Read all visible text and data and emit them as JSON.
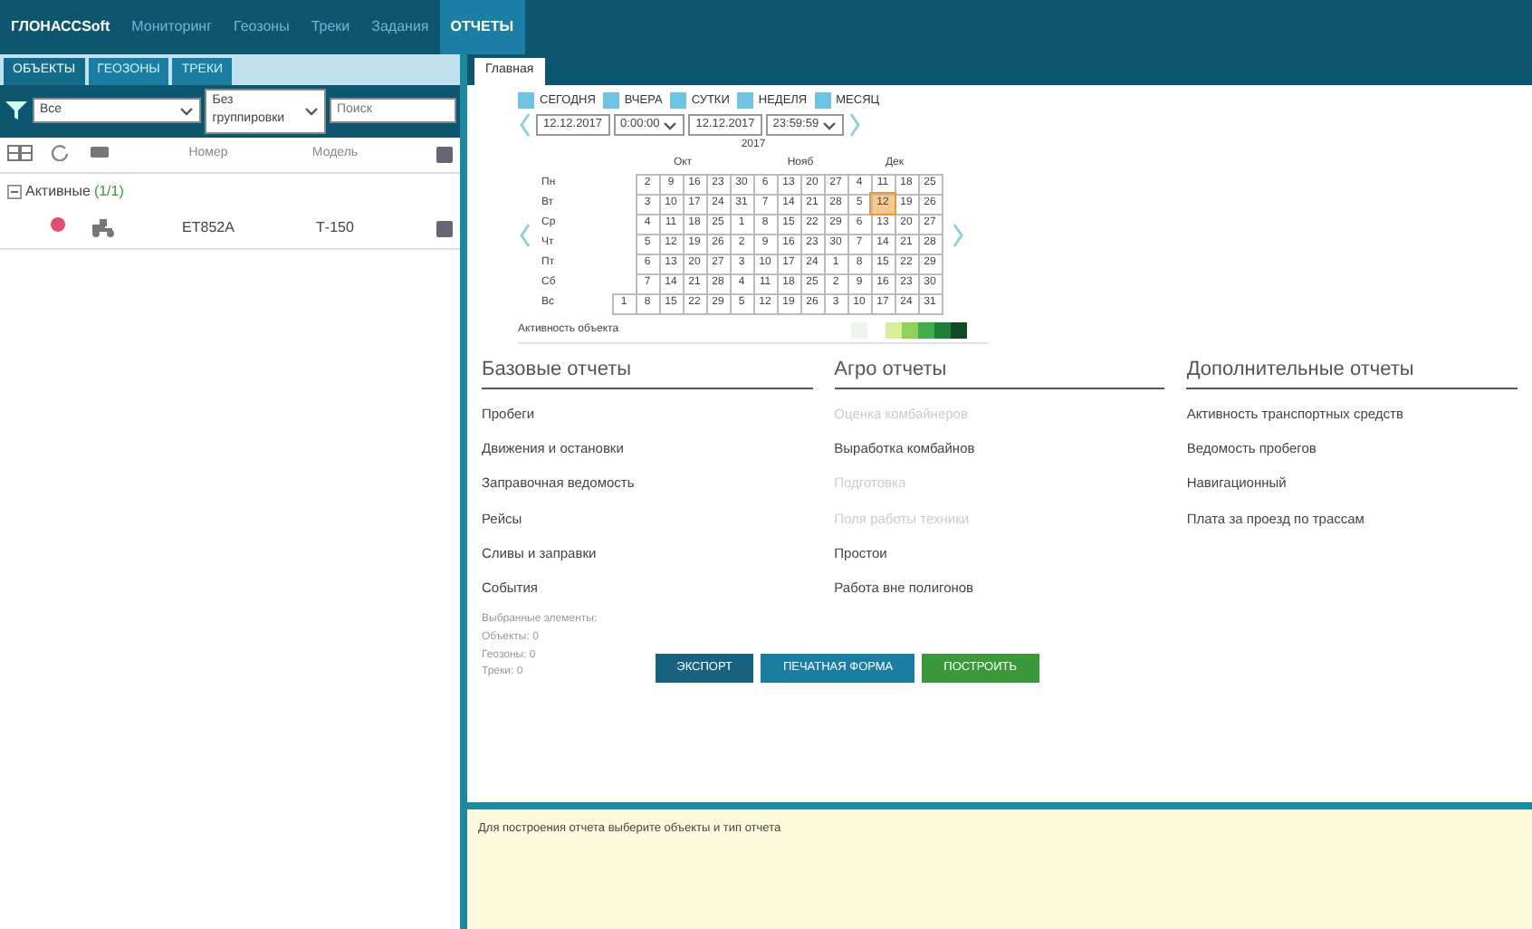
{
  "app": {
    "logo": "ГЛОНАССSoft",
    "menu": [
      {
        "label": "Мониторинг",
        "selected": false
      },
      {
        "label": "Геозоны",
        "selected": false
      },
      {
        "label": "Треки",
        "selected": false
      },
      {
        "label": "Задания",
        "selected": false
      },
      {
        "label": "ОТЧЕТЫ",
        "selected": true
      }
    ],
    "left_panel": {
      "tabs": [
        {
          "label": "ОБЪЕКТЫ",
          "selected": true
        },
        {
          "label": "ГЕОЗОНЫ",
          "selected": false
        },
        {
          "label": "ТРЕКИ",
          "selected": false
        }
      ],
      "filter": {
        "group": "Все",
        "grouping": "Без группировки",
        "search_placeholder": "Поиск"
      },
      "columns": [
        "Номер",
        "Модель"
      ],
      "groups": [
        {
          "name": "Активные",
          "count": "(1/1)",
          "expanded": true,
          "rows": [
            {
              "color": "#e0506a",
              "number": "ЕТ852А",
              "model": "Т-150"
            }
          ]
        }
      ]
    },
    "right_panel": {
      "tabs": [
        {
          "label": "Главная",
          "selected": true
        }
      ],
      "periods": [
        {
          "label": "СЕГОДНЯ",
          "checked": false
        },
        {
          "label": "ВЧЕРА",
          "checked": false
        },
        {
          "label": "СУТКИ",
          "checked": false
        },
        {
          "label": "НЕДЕЛЯ",
          "checked": false
        },
        {
          "label": "МЕСЯЦ",
          "checked": false
        }
      ],
      "from": {
        "date": "12.12.2017",
        "time": "0:00:00"
      },
      "to": {
        "date": "12.12.2017",
        "time": "23:59:59"
      },
      "calendar": {
        "year": "2017",
        "months": [
          "Окт",
          "Нояб",
          "Дек"
        ],
        "rows": [
          {
            "weekday": "Пн",
            "days": [
              {
                "day": "2",
                "selected": false
              },
              {
                "day": "9",
                "selected": false
              },
              {
                "day": "16",
                "selected": false
              },
              {
                "day": "23",
                "selected": false
              },
              {
                "day": "30",
                "selected": false
              },
              {
                "day": "6",
                "selected": false
              },
              {
                "day": "13",
                "selected": false
              },
              {
                "day": "20",
                "selected": false
              },
              {
                "day": "27",
                "selected": false
              },
              {
                "day": "4",
                "selected": false
              },
              {
                "day": "11",
                "selected": false
              },
              {
                "day": "18",
                "selected": false
              },
              {
                "day": "25",
                "selected": false
              }
            ]
          },
          {
            "weekday": "Вт",
            "days": [
              {
                "day": "3",
                "selected": false
              },
              {
                "day": "10",
                "selected": false
              },
              {
                "day": "17",
                "selected": false
              },
              {
                "day": "24",
                "selected": false
              },
              {
                "day": "31",
                "selected": false
              },
              {
                "day": "7",
                "selected": false
              },
              {
                "day": "14",
                "selected": false
              },
              {
                "day": "21",
                "selected": false
              },
              {
                "day": "28",
                "selected": false
              },
              {
                "day": "5",
                "selected": false
              },
              {
                "day": "12",
                "selected": true
              },
              {
                "day": "19",
                "selected": false
              },
              {
                "day": "26",
                "selected": false
              }
            ]
          },
          {
            "weekday": "Ср",
            "days": [
              {
                "day": "4",
                "selected": false
              },
              {
                "day": "11",
                "selected": false
              },
              {
                "day": "18",
                "selected": false
              },
              {
                "day": "25",
                "selected": false
              },
              {
                "day": "1",
                "selected": false
              },
              {
                "day": "8",
                "selected": false
              },
              {
                "day": "15",
                "selected": false
              },
              {
                "day": "22",
                "selected": false
              },
              {
                "day": "29",
                "selected": false
              },
              {
                "day": "6",
                "selected": false
              },
              {
                "day": "13",
                "selected": false
              },
              {
                "day": "20",
                "selected": false
              },
              {
                "day": "27",
                "selected": false
              }
            ]
          },
          {
            "weekday": "Чт",
            "days": [
              {
                "day": "5",
                "selected": false
              },
              {
                "day": "12",
                "selected": false
              },
              {
                "day": "19",
                "selected": false
              },
              {
                "day": "26",
                "selected": false
              },
              {
                "day": "2",
                "selected": false
              },
              {
                "day": "9",
                "selected": false
              },
              {
                "day": "16",
                "selected": false
              },
              {
                "day": "23",
                "selected": false
              },
              {
                "day": "30",
                "selected": false
              },
              {
                "day": "7",
                "selected": false
              },
              {
                "day": "14",
                "selected": false
              },
              {
                "day": "21",
                "selected": false
              },
              {
                "day": "28",
                "selected": false
              }
            ]
          },
          {
            "weekday": "Пт",
            "days": [
              {
                "day": "6",
                "selected": false
              },
              {
                "day": "13",
                "selected": false
              },
              {
                "day": "20",
                "selected": false
              },
              {
                "day": "27",
                "selected": false
              },
              {
                "day": "3",
                "selected": false
              },
              {
                "day": "10",
                "selected": false
              },
              {
                "day": "17",
                "selected": false
              },
              {
                "day": "24",
                "selected": false
              },
              {
                "day": "1",
                "selected": false
              },
              {
                "day": "8",
                "selected": false
              },
              {
                "day": "15",
                "selected": false
              },
              {
                "day": "22",
                "selected": false
              },
              {
                "day": "29",
                "selected": false
              }
            ]
          },
          {
            "weekday": "Сб",
            "days": [
              {
                "day": "7",
                "selected": false
              },
              {
                "day": "14",
                "selected": false
              },
              {
                "day": "21",
                "selected": false
              },
              {
                "day": "28",
                "selected": false
              },
              {
                "day": "4",
                "selected": false
              },
              {
                "day": "11",
                "selected": false
              },
              {
                "day": "18",
                "selected": false
              },
              {
                "day": "25",
                "selected": false
              },
              {
                "day": "2",
                "selected": false
              },
              {
                "day": "9",
                "selected": false
              },
              {
                "day": "16",
                "selected": false
              },
              {
                "day": "23",
                "selected": false
              },
              {
                "day": "30",
                "selected": false
              }
            ]
          },
          {
            "weekday": "Вс",
            "days": [
              {
                "day": "1",
                "selected": false
              },
              {
                "day": "8",
                "selected": false
              },
              {
                "day": "15",
                "selected": false
              },
              {
                "day": "22",
                "selected": false
              },
              {
                "day": "29",
                "selected": false
              },
              {
                "day": "5",
                "selected": false
              },
              {
                "day": "12",
                "selected": false
              },
              {
                "day": "19",
                "selected": false
              },
              {
                "day": "26",
                "selected": false
              },
              {
                "day": "3",
                "selected": false
              },
              {
                "day": "10",
                "selected": false
              },
              {
                "day": "17",
                "selected": false
              },
              {
                "day": "24",
                "selected": false
              },
              {
                "day": "31",
                "selected": false
              }
            ]
          }
        ]
      },
      "activity": {
        "label": "Активность объекта",
        "levels": [
          {
            "color": "#eef3ee"
          },
          {
            "color": "#d8ef9a"
          },
          {
            "color": "#8fd25a"
          },
          {
            "color": "#3fae4a"
          },
          {
            "color": "#1d7d3a"
          },
          {
            "color": "#0e4a26"
          }
        ]
      },
      "sections": [
        {
          "title": "Базовые отчеты",
          "items": [
            {
              "label": "Пробеги",
              "disabled": false
            },
            {
              "label": "Движения и остановки",
              "disabled": false
            },
            {
              "label": "Заправочная ведомость",
              "disabled": false
            },
            {
              "label": "Рейсы",
              "disabled": false
            },
            {
              "label": "Сливы и заправки",
              "disabled": false
            },
            {
              "label": "События",
              "disabled": false
            }
          ]
        },
        {
          "title": "Агро отчеты",
          "items": [
            {
              "label": "Оценка комбайнеров",
              "disabled": true
            },
            {
              "label": "Выработка комбайнов",
              "disabled": false
            },
            {
              "label": "Подготовка",
              "disabled": true
            },
            {
              "label": "Поля работы техники",
              "disabled": true
            },
            {
              "label": "Простои",
              "disabled": false
            },
            {
              "label": "Работа вне полигонов",
              "disabled": false
            }
          ]
        },
        {
          "title": "Дополнительные отчеты",
          "items": [
            {
              "label": "Активность транспортных средств",
              "disabled": false
            },
            {
              "label": "Ведомость пробегов",
              "disabled": false
            },
            {
              "label": "Навигационный",
              "disabled": false
            },
            {
              "label": "Плата за проезд по трассам",
              "disabled": false
            }
          ]
        }
      ],
      "selection": [
        "Выбранные элементы:",
        "Объекты: 0",
        "Геозоны: 0",
        "Треки: 0"
      ],
      "buttons": [
        {
          "label": "ЭКСПОРТ",
          "kind": "export"
        },
        {
          "label": "ПЕЧАТНАЯ ФОРМА",
          "kind": "print"
        },
        {
          "label": "ПОСТРОИТЬ",
          "kind": "build"
        }
      ],
      "message": "Для построения отчета выберите объекты и тип отчета"
    }
  }
}
